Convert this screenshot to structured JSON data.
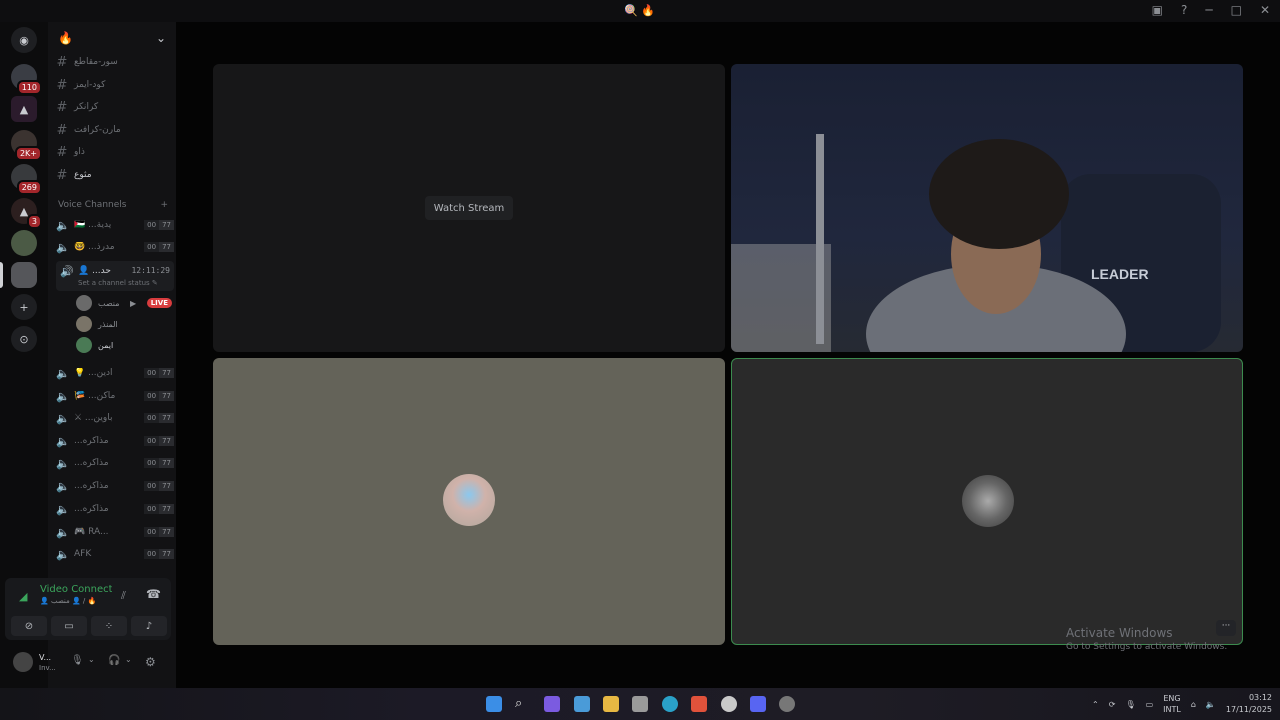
{
  "titlebar": {
    "app_icons": "🍭 🔥"
  },
  "guild_badges": [
    "110",
    "2K+",
    "269",
    "3"
  ],
  "guild": {
    "name_icon": "🔥"
  },
  "text_channels": [
    "سور-مقاطع",
    "كود-ايمز",
    "كرانكر",
    "مارن-كرافت",
    "ذاو",
    "مثوع"
  ],
  "voice_category": "Voice Channels",
  "voice_channels_top": [
    {
      "name": "🇵🇸 ...يدية",
      "c1": "00",
      "c2": "77"
    },
    {
      "name": "🤓 ...مدرذ",
      "c1": "00",
      "c2": "77"
    }
  ],
  "active_channel": {
    "name": "👤 ...حد",
    "time": "12:11:29",
    "status": "Set a channel status ✎",
    "members": [
      {
        "name": "منصب",
        "live": "LIVE"
      },
      {
        "name": "المنذر"
      },
      {
        "name": "ايمن"
      }
    ]
  },
  "voice_channels_bottom": [
    {
      "name": "💡 ...ادين",
      "c1": "00",
      "c2": "77"
    },
    {
      "name": "🎏 ...ماكن",
      "c1": "00",
      "c2": "77"
    },
    {
      "name": "⚔ ...باوين",
      "c1": "00",
      "c2": "77"
    },
    {
      "name": "...مذاكره",
      "c1": "00",
      "c2": "77"
    },
    {
      "name": "...مذاكره",
      "c1": "00",
      "c2": "77"
    },
    {
      "name": "...مذاكره",
      "c1": "00",
      "c2": "77"
    },
    {
      "name": "...مذاكره",
      "c1": "00",
      "c2": "77"
    },
    {
      "name": "🎮 RA...",
      "c1": "00",
      "c2": "77"
    },
    {
      "name": "AFK",
      "c1": "00",
      "c2": "77"
    }
  ],
  "voice_panel": {
    "status": "Video Connected",
    "sub": "👤 منصب 👤 / 🔥"
  },
  "user_panel": {
    "name": "V...",
    "status": "Inv..."
  },
  "stage": {
    "watch_stream": "Watch Stream",
    "camera_text": "LEADER"
  },
  "watermark": {
    "title": "Activate Windows",
    "sub": "Go to Settings to activate Windows."
  },
  "tray": {
    "lang1": "ENG",
    "lang2": "INTL",
    "time": "03:12",
    "date": "17/11/2025"
  }
}
